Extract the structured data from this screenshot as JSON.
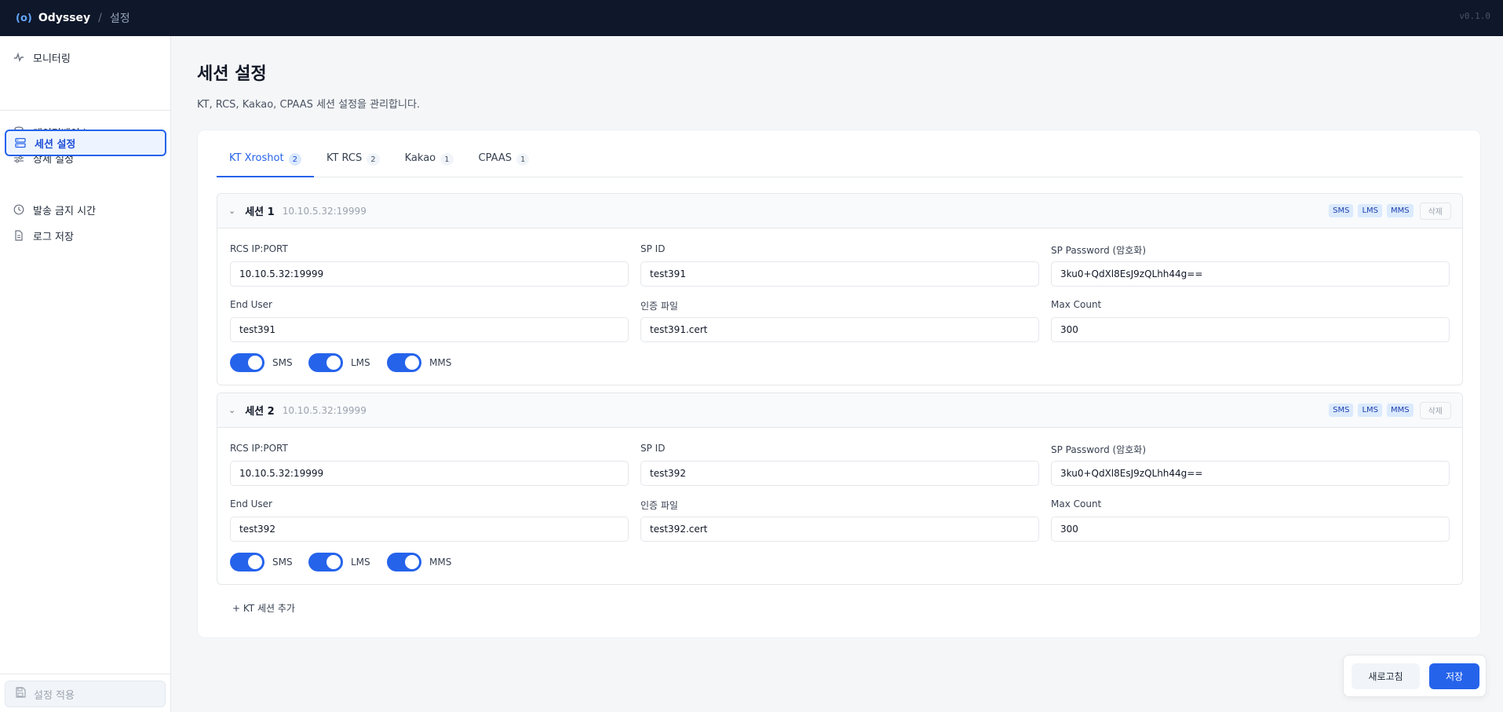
{
  "topbar": {
    "logo_mark": "(o)",
    "app_name": "Odyssey",
    "separator": "/",
    "breadcrumb": "설정",
    "version": "v0.1.0"
  },
  "sidebar": {
    "items": [
      {
        "label": "모니터링",
        "icon": "activity-icon"
      },
      {
        "label": "데이터베이스",
        "icon": "database-icon"
      },
      {
        "label": "상세 설정",
        "icon": "sliders-icon"
      },
      {
        "label": "세션 설정",
        "icon": "server-icon",
        "active": true
      },
      {
        "label": "발송 금지 시간",
        "icon": "clock-icon"
      },
      {
        "label": "로그 저장",
        "icon": "file-icon"
      }
    ],
    "apply_label": "설정 적용"
  },
  "page": {
    "title": "세션 설정",
    "subtitle": "KT, RCS, Kakao, CPAAS 세션 설정을 관리합니다."
  },
  "tabs": [
    {
      "label": "KT Xroshot",
      "count": "2",
      "active": true
    },
    {
      "label": "KT RCS",
      "count": "2"
    },
    {
      "label": "Kakao",
      "count": "1"
    },
    {
      "label": "CPAAS",
      "count": "1"
    }
  ],
  "field_labels": {
    "rcs_ip_port": "RCS IP:PORT",
    "sp_id": "SP ID",
    "sp_password": "SP Password (암호화)",
    "end_user": "End User",
    "cert_file": "인증 파일",
    "max_count": "Max Count"
  },
  "sessions": [
    {
      "name": "세션 1",
      "addr": "10.10.5.32:19999",
      "chevron": "⌄",
      "badges": [
        "SMS",
        "LMS",
        "MMS"
      ],
      "delete_label": "삭제",
      "rcs_ip_port": "10.10.5.32:19999",
      "sp_id": "test391",
      "sp_password": "3ku0+QdXl8EsJ9zQLhh44g==",
      "end_user": "test391",
      "cert_file": "test391.cert",
      "max_count": "300",
      "toggles": [
        {
          "label": "SMS",
          "on": true
        },
        {
          "label": "LMS",
          "on": true
        },
        {
          "label": "MMS",
          "on": true
        }
      ]
    },
    {
      "name": "세션 2",
      "addr": "10.10.5.32:19999",
      "chevron": "⌄",
      "badges": [
        "SMS",
        "LMS",
        "MMS"
      ],
      "delete_label": "삭제",
      "rcs_ip_port": "10.10.5.32:19999",
      "sp_id": "test392",
      "sp_password": "3ku0+QdXl8EsJ9zQLhh44g==",
      "end_user": "test392",
      "cert_file": "test392.cert",
      "max_count": "300",
      "toggles": [
        {
          "label": "SMS",
          "on": true
        },
        {
          "label": "LMS",
          "on": true
        },
        {
          "label": "MMS",
          "on": true
        }
      ]
    }
  ],
  "add_session_label": "+ KT 세션 추가",
  "footer": {
    "refresh_label": "새로고침",
    "save_label": "저장"
  },
  "colors": {
    "accent": "#2563eb",
    "topbar_bg": "#0f172a"
  }
}
